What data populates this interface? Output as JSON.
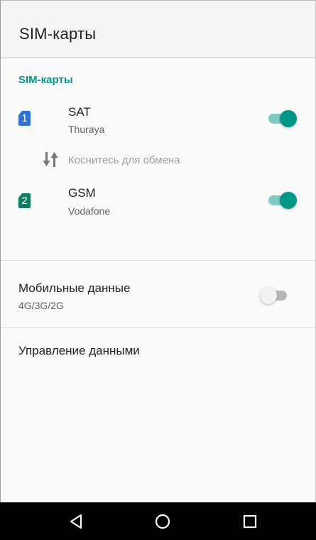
{
  "appbar": {
    "title": "SIM-карты"
  },
  "section": {
    "header": "SIM-карты"
  },
  "sims": [
    {
      "slot": "1",
      "name": "SAT",
      "operator": "Thuraya",
      "enabled": true,
      "badge_color": "#2f6fd6"
    },
    {
      "slot": "2",
      "name": "GSM",
      "operator": "Vodafone",
      "enabled": true,
      "badge_color": "#0f7d66"
    }
  ],
  "swap": {
    "label": "Коснитесь для обмена",
    "icon": "swap-vert-icon"
  },
  "mobile_data": {
    "title": "Мобильные данные",
    "subtitle": "4G/3G/2G",
    "enabled": false
  },
  "data_management": {
    "title": "Управление данными"
  },
  "navbar": {
    "back": "back-icon",
    "home": "home-icon",
    "recents": "recents-icon"
  },
  "colors": {
    "accent": "#009688",
    "accent_light": "#7fcbc3",
    "navbar": "#000000"
  }
}
